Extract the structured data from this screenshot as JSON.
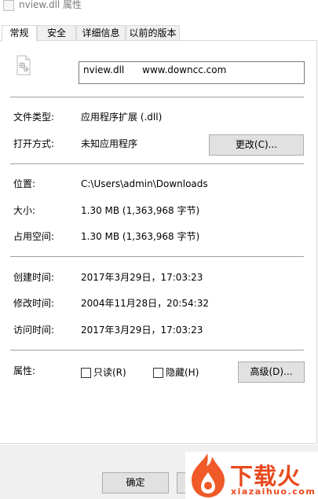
{
  "window": {
    "title": "nview.dll 属性"
  },
  "tabs": [
    {
      "label": "常规",
      "active": true
    },
    {
      "label": "安全",
      "active": false
    },
    {
      "label": "详细信息",
      "active": false
    },
    {
      "label": "以前的版本",
      "active": false
    }
  ],
  "file": {
    "icon": "dll-file-gear-icon",
    "name_value": "nview.dll      www.downcc.com"
  },
  "general": {
    "type_label": "文件类型:",
    "type_value": "应用程序扩展 (.dll)",
    "open_label": "打开方式:",
    "open_value": "未知应用程序",
    "change_button": "更改(C)..."
  },
  "location": {
    "path_label": "位置:",
    "path_value": "C:\\Users\\admin\\Downloads",
    "size_label": "大小:",
    "size_value": "1.30 MB (1,363,968 字节)",
    "disk_label": "占用空间:",
    "disk_value": "1.30 MB (1,363,968 字节)"
  },
  "times": {
    "created_label": "创建时间:",
    "created_value": "2017年3月29日，17:03:23",
    "modified_label": "修改时间:",
    "modified_value": "2004年11月28日，20:54:32",
    "accessed_label": "访问时间:",
    "accessed_value": "2017年3月29日，17:03:23"
  },
  "attributes": {
    "label": "属性:",
    "readonly_label": "只读(R)",
    "readonly_checked": false,
    "hidden_label": "隐藏(H)",
    "hidden_checked": false,
    "advanced_button": "高级(D)..."
  },
  "footer": {
    "ok_button": "确定"
  },
  "watermark": {
    "brand": "下载火",
    "domain": "xiazaihuo.com",
    "brand_color": "#e8491d"
  }
}
